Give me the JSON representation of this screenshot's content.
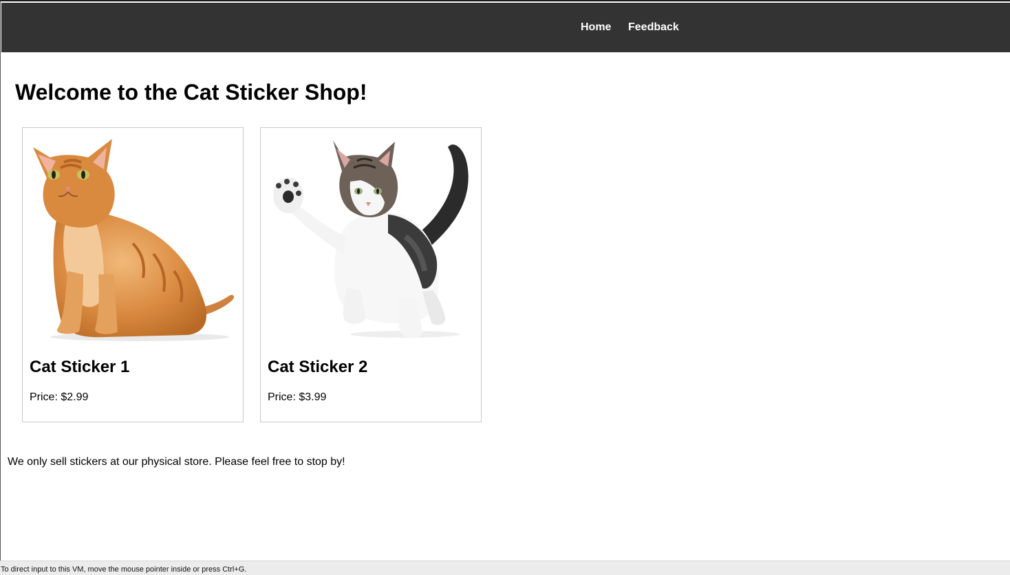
{
  "nav": {
    "home_label": "Home",
    "feedback_label": "Feedback"
  },
  "page": {
    "title": "Welcome to the Cat Sticker Shop!"
  },
  "products": [
    {
      "name": "Cat Sticker 1",
      "price": "Price: $2.99",
      "image": "orange-tabby-cat-sitting"
    },
    {
      "name": "Cat Sticker 2",
      "price": "Price: $3.99",
      "image": "white-tabby-kitten-raising-paw"
    }
  ],
  "notice": "We only sell stickers at our physical store. Please feel free to stop by!",
  "vm_status": "To direct input to this VM, move the mouse pointer inside or press Ctrl+G.",
  "colors": {
    "navbar": "#333333",
    "nav_text": "#ffffff",
    "card_border": "#c8c8c8",
    "status_bar": "#ececec"
  }
}
